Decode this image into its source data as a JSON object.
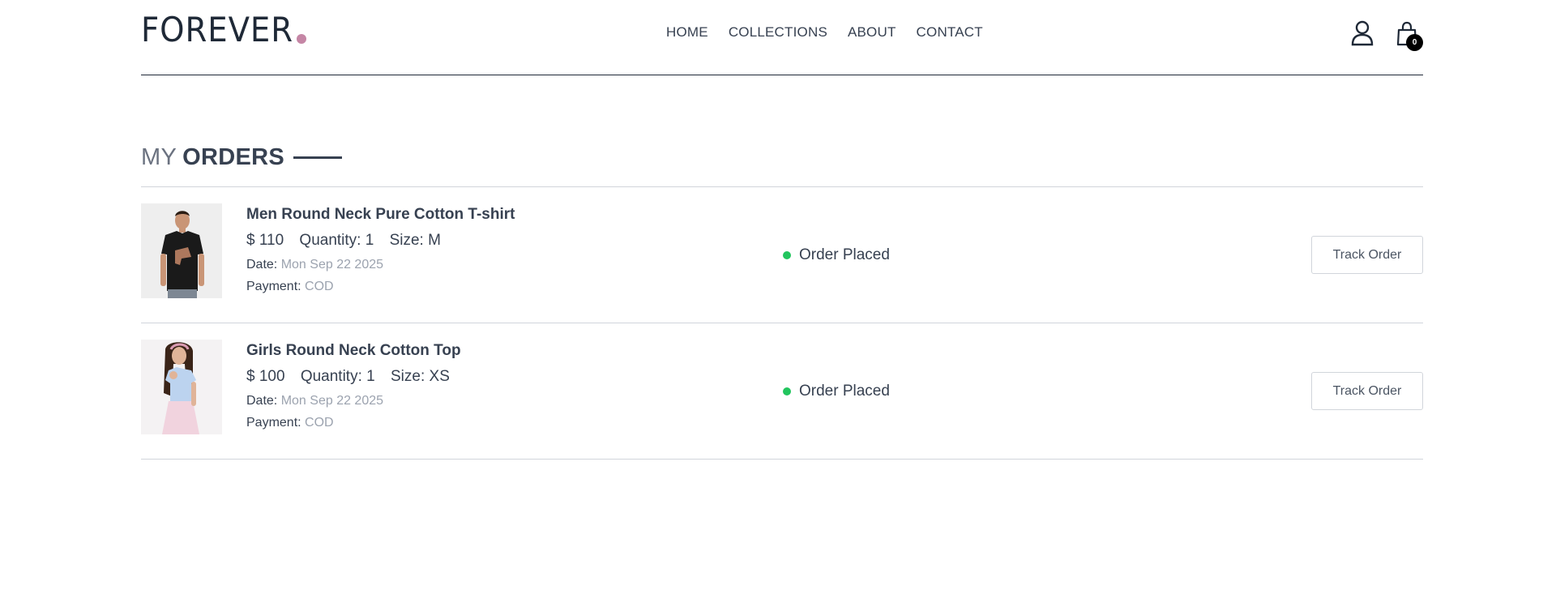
{
  "brand": {
    "logo_text": "FOREVER",
    "accent_dot_color": "#c586a5"
  },
  "nav": {
    "items": [
      {
        "label": "HOME"
      },
      {
        "label": "COLLECTIONS"
      },
      {
        "label": "ABOUT"
      },
      {
        "label": "CONTACT"
      }
    ]
  },
  "header_icons": {
    "profile": "user-icon",
    "cart": "shopping-bag-icon",
    "cart_count": "0"
  },
  "page": {
    "title_light": "MY",
    "title_bold": "ORDERS"
  },
  "orders": [
    {
      "name": "Men Round Neck Pure Cotton T-shirt",
      "price": "$ 110",
      "quantity": "Quantity: 1",
      "size": "Size: M",
      "date_label": "Date:",
      "date_value": "Mon Sep 22 2025",
      "payment_label": "Payment:",
      "payment_value": "COD",
      "status": "Order Placed",
      "status_color": "#22c55e",
      "action": "Track Order"
    },
    {
      "name": "Girls Round Neck Cotton Top",
      "price": "$ 100",
      "quantity": "Quantity: 1",
      "size": "Size: XS",
      "date_label": "Date:",
      "date_value": "Mon Sep 22 2025",
      "payment_label": "Payment:",
      "payment_value": "COD",
      "status": "Order Placed",
      "status_color": "#22c55e",
      "action": "Track Order"
    }
  ]
}
